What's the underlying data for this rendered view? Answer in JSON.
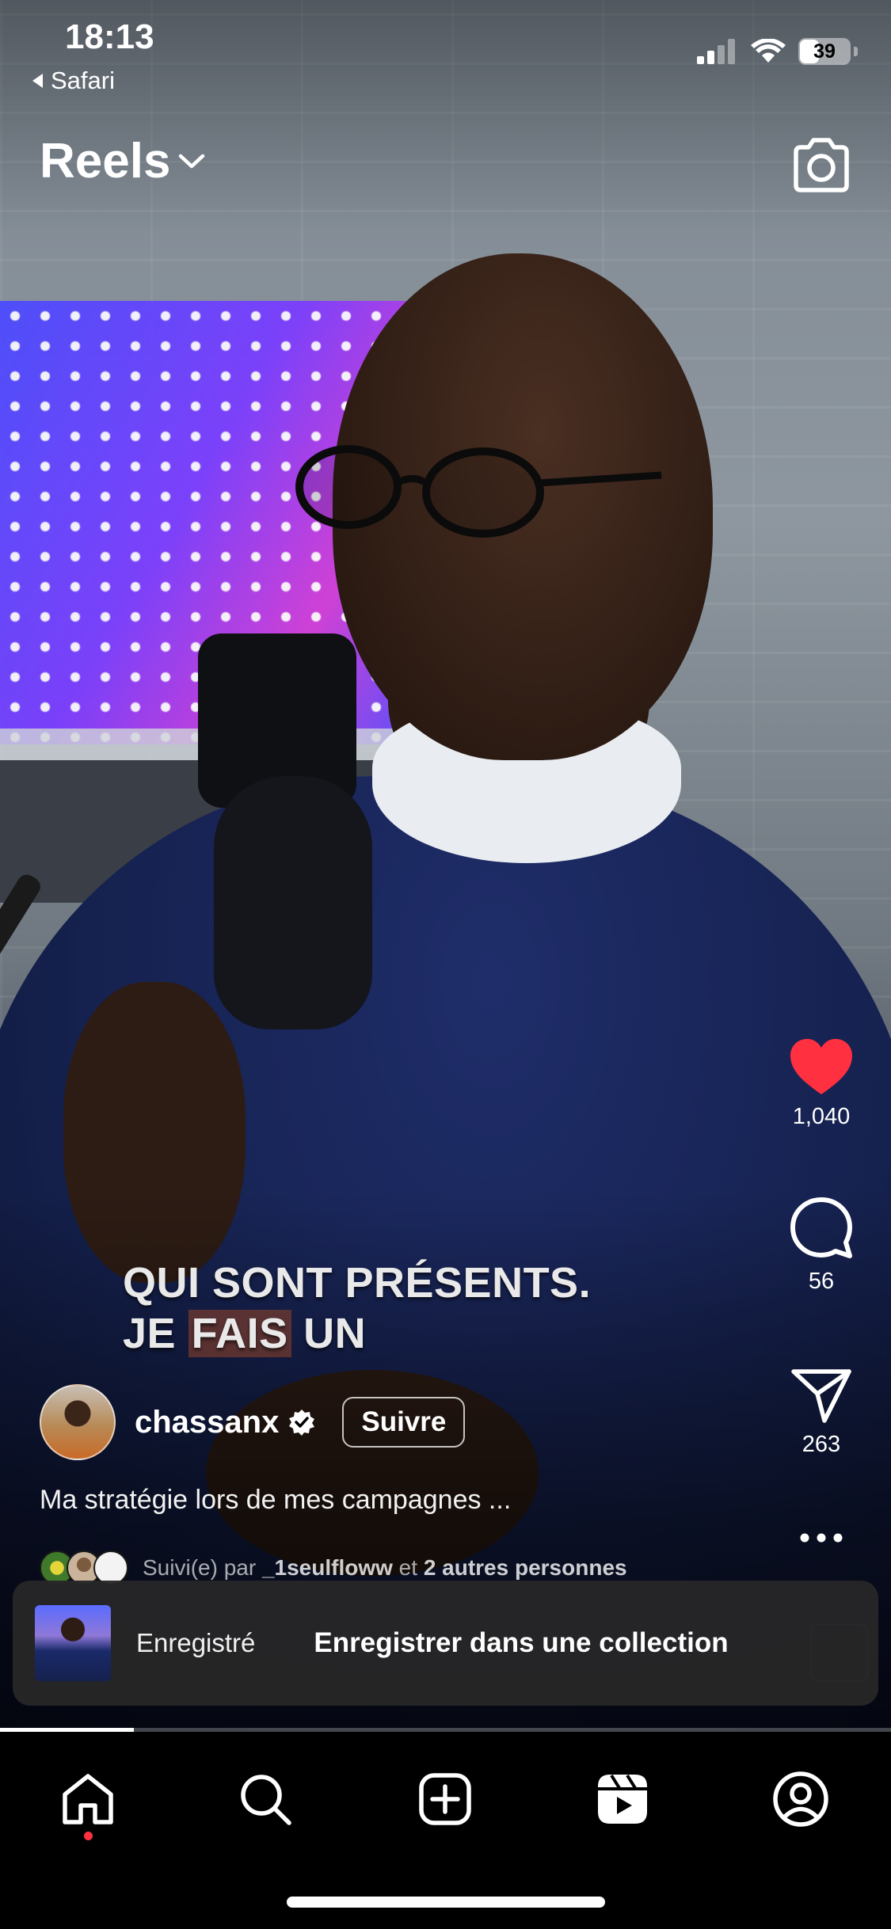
{
  "status_bar": {
    "time": "18:13",
    "back_label": "Safari",
    "battery": "39",
    "battery_level": 0.39
  },
  "header": {
    "title": "Reels",
    "dropdown_icon": "chevron-down-icon",
    "camera_icon": "camera-icon"
  },
  "video": {
    "caption_line1": "QUI SONT PRÉSENTS.",
    "caption_line2_a": "JE ",
    "caption_line2_highlight": "FAIS",
    "caption_line2_b": " UN"
  },
  "actions": {
    "likes": "1,040",
    "liked": true,
    "like_color": "#ff3040",
    "comments": "56",
    "shares": "263"
  },
  "post": {
    "username": "chassanx",
    "verified": true,
    "follow_label": "Suivre",
    "description": "Ma stratégie lors de mes campagnes ...",
    "followed_prefix": "Suivi(e) par ",
    "followed_user": "_1seulfloww",
    "followed_mid": " et ",
    "followed_others": "2 autres personnes"
  },
  "toast": {
    "status": "Enregistré",
    "action": "Enregistrer dans une collection"
  },
  "progress": {
    "fraction": 0.15
  },
  "nav": {
    "items": [
      "home-icon",
      "search-icon",
      "create-post-icon",
      "reels-icon",
      "profile-icon"
    ],
    "active": "home-icon",
    "notification_dot_color": "#ff3040"
  }
}
